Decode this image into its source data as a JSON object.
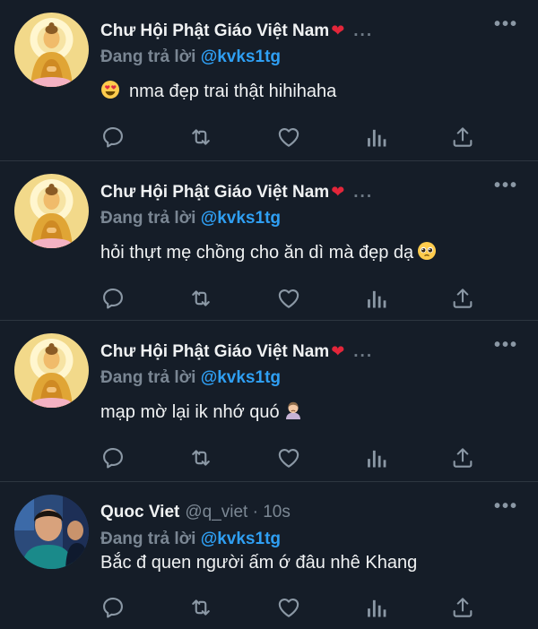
{
  "colors": {
    "background": "#151d28",
    "text": "#f0f2f3",
    "secondary": "#7a8693",
    "mention": "#2f9ff3",
    "heart": "#e3263a"
  },
  "tweets": [
    {
      "name": "Chư Hội Phật Giáo Việt Nam",
      "name_icon": "red-heart-icon",
      "header_extra": "...",
      "reply_prefix": "Đang trả lời",
      "mention": "@kvks1tg",
      "text": "nma đẹp trai thật hihihaha",
      "emoji_leading": "heart-eyes-emoji",
      "avatar": "buddha-avatar"
    },
    {
      "name": "Chư Hội Phật Giáo Việt Nam",
      "name_icon": "red-heart-icon",
      "header_extra": "...",
      "reply_prefix": "Đang trả lời",
      "mention": "@kvks1tg",
      "text": "hỏi thựt mẹ chồng cho ăn dì mà đẹp dạ",
      "emoji_trailing": "pleading-face-emoji",
      "avatar": "buddha-avatar"
    },
    {
      "name": "Chư Hội Phật Giáo Việt Nam",
      "name_icon": "red-heart-icon",
      "header_extra": "...",
      "reply_prefix": "Đang trả lời",
      "mention": "@kvks1tg",
      "text": "mạp mờ lại ik nhớ quó",
      "emoji_trailing": "person-frowning-emoji",
      "avatar": "buddha-avatar"
    },
    {
      "name": "Quoc Viet",
      "handle": "@q_viet · 10s",
      "reply_prefix": "Đang trả lời",
      "mention": "@kvks1tg",
      "text": "Bắc đ quen người ấm ớ đâu nhê Khang",
      "avatar": "person-photo-avatar"
    }
  ],
  "more_label": "•••",
  "actions": [
    "reply-icon",
    "retweet-icon",
    "like-icon",
    "analytics-icon",
    "share-icon"
  ]
}
